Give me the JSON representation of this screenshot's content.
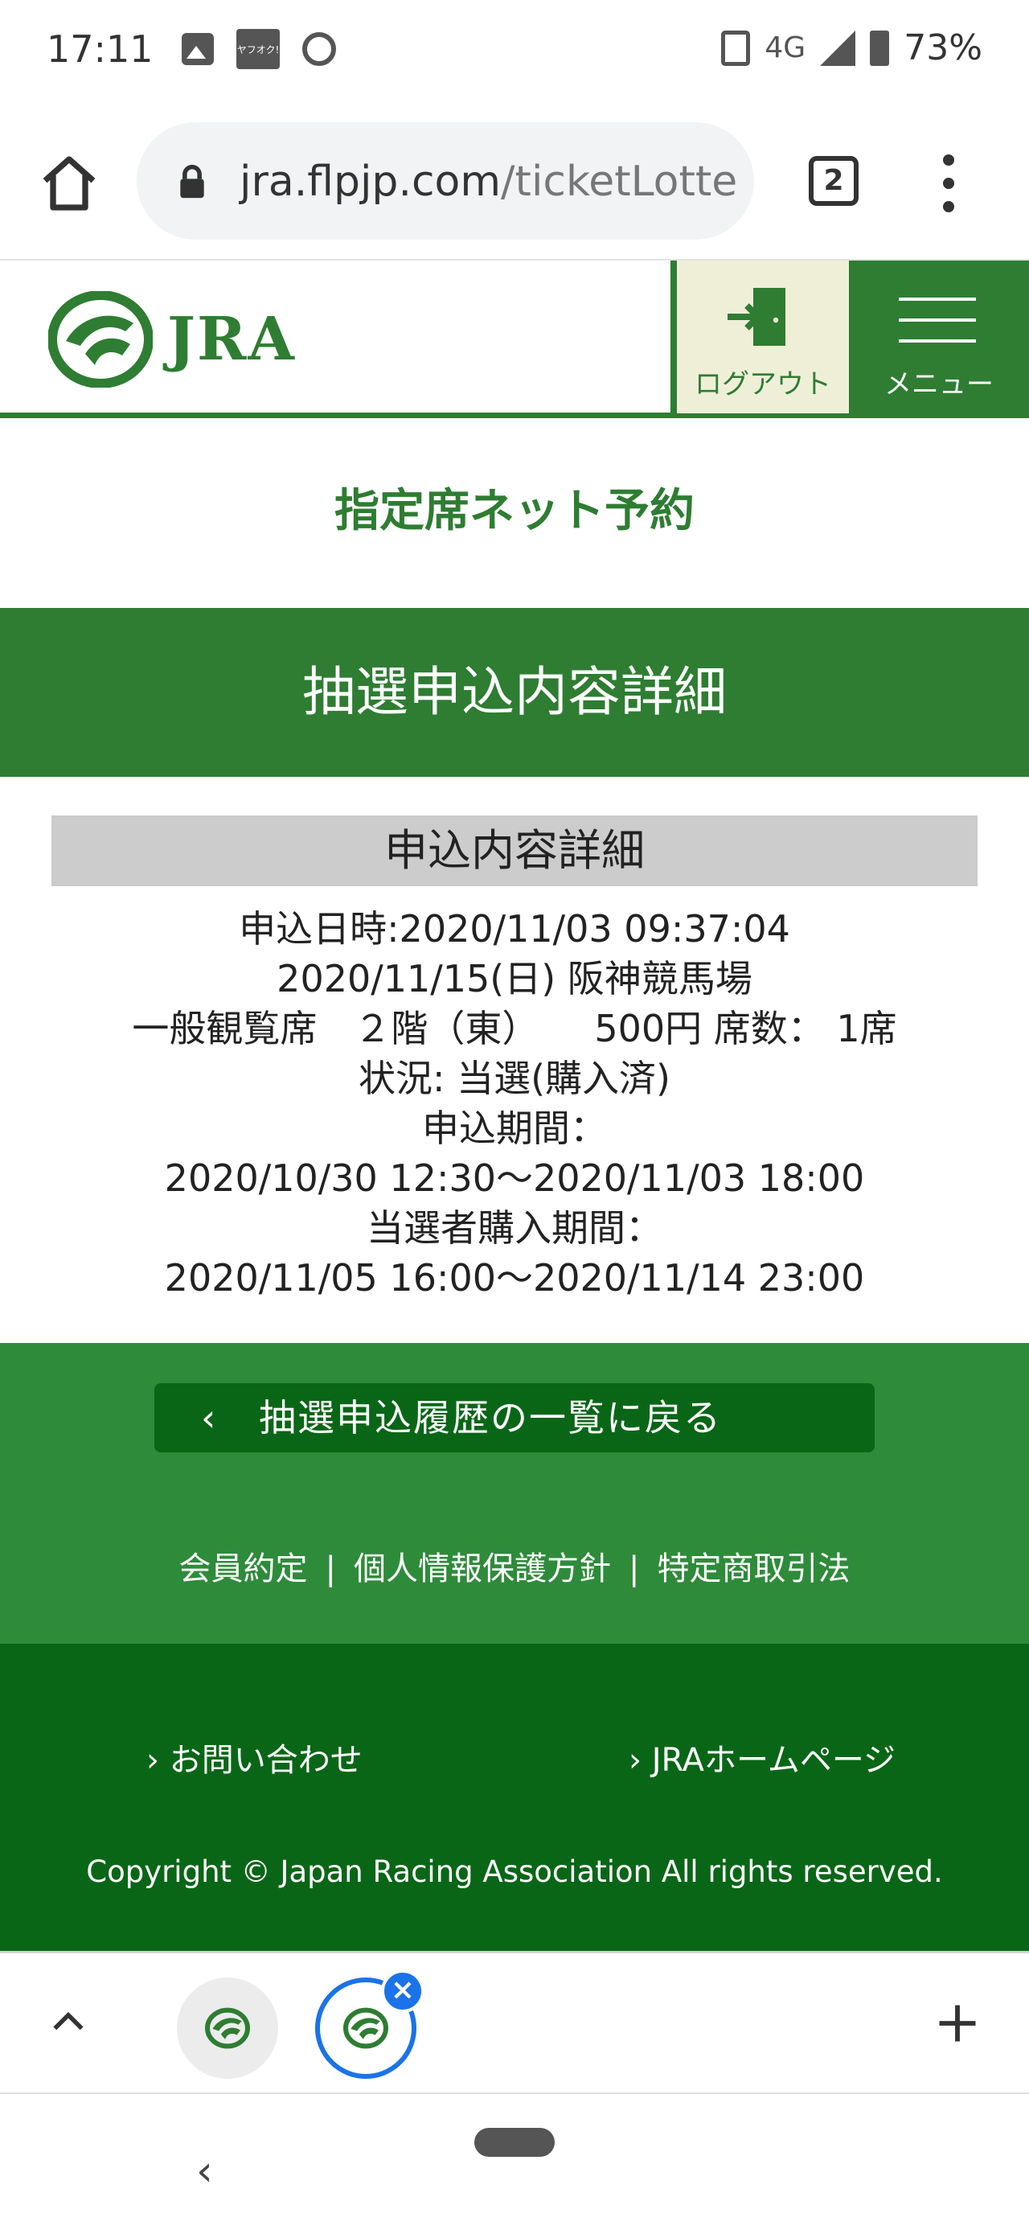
{
  "status_bar": {
    "time": "17:11",
    "network": "4G",
    "battery": "73%",
    "yahoo_label": "ヤフオク!"
  },
  "browser": {
    "url_domain": "jra.flpjp.com",
    "url_path": "/ticketLotte",
    "tab_count": "2"
  },
  "header": {
    "logo_text": "JRA",
    "logout_label": "ログアウト",
    "menu_label": "メニュー",
    "accent_color": "#2e7d32"
  },
  "main": {
    "service_title": "指定席ネット予約",
    "page_heading": "抽選申込内容詳細",
    "detail_heading": "申込内容詳細",
    "detail_lines": [
      "申込日時:2020/11/03 09:37:04",
      "2020/11/15(日) 阪神競馬場",
      "一般観覧席　２階（東）　　500円 席数： 1席",
      "状況: 当選(購入済)",
      "申込期間：",
      "2020/10/30 12:30〜2020/11/03 18:00",
      "当選者購入期間：",
      "2020/11/05 16:00〜2020/11/14 23:00"
    ],
    "back_chevron": "‹",
    "back_button": "抽選申込履歴の一覧に戻る"
  },
  "footer": {
    "links": [
      "会員約定",
      "個人情報保護方針",
      "特定商取引法"
    ],
    "separator": "|",
    "contact": "› お問い合わせ",
    "homepage": "› JRAホームページ",
    "copyright": "Copyright © Japan Racing Association All rights reserved."
  },
  "tab_strip": {
    "close_glyph": "×"
  },
  "nav_bar": {
    "back_glyph": "‹"
  }
}
